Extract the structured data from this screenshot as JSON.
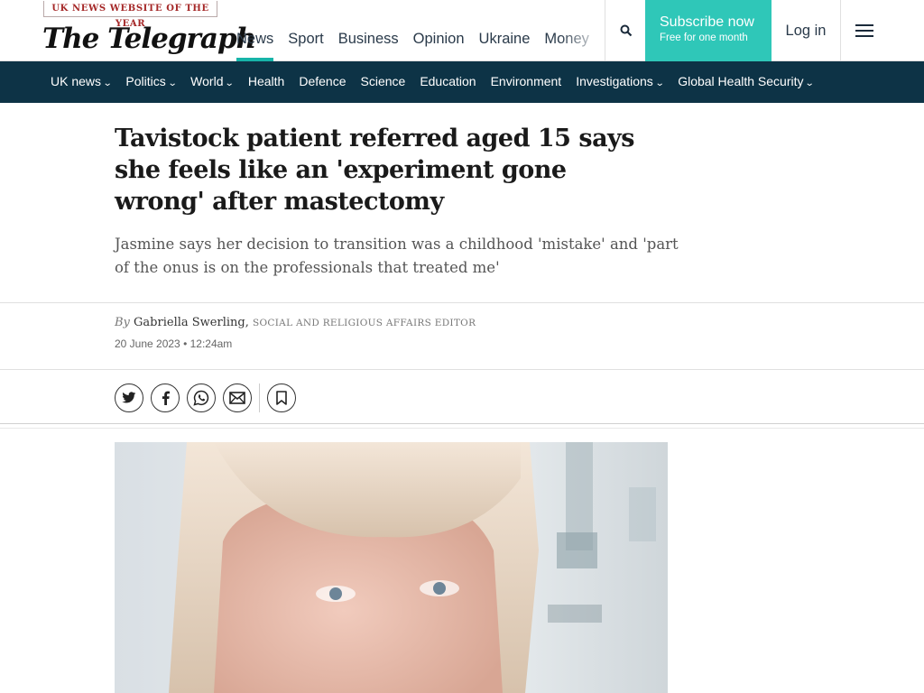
{
  "header": {
    "award_badge": "UK NEWS WEBSITE OF THE YEAR",
    "logo_text": "The Telegraph",
    "nav": [
      {
        "label": "News",
        "active": true
      },
      {
        "label": "Sport"
      },
      {
        "label": "Business"
      },
      {
        "label": "Opinion"
      },
      {
        "label": "Ukraine"
      },
      {
        "label": "Money"
      }
    ],
    "search_icon": "search-icon",
    "subscribe": {
      "title": "Subscribe now",
      "subtitle": "Free for one month"
    },
    "login_label": "Log in",
    "menu_icon": "hamburger-menu-icon",
    "accent_color": "#2fc7b8"
  },
  "section_nav": {
    "background": "#0d3346",
    "items": [
      {
        "label": "UK news",
        "dropdown": true
      },
      {
        "label": "Politics",
        "dropdown": true
      },
      {
        "label": "World",
        "dropdown": true
      },
      {
        "label": "Health"
      },
      {
        "label": "Defence"
      },
      {
        "label": "Science"
      },
      {
        "label": "Education"
      },
      {
        "label": "Environment"
      },
      {
        "label": "Investigations",
        "dropdown": true
      },
      {
        "label": "Global Health Security",
        "dropdown": true
      }
    ]
  },
  "article": {
    "headline": "Tavistock patient referred aged 15 says she feels like an 'experiment gone wrong' after mastectomy",
    "standfirst": "Jasmine says her decision to transition was a childhood 'mistake' and 'part of the onus is on the professionals that treated me'",
    "byline_prefix": "By",
    "author": "Gabriella Swerling,",
    "author_role": "Social and Religious Affairs Editor",
    "date": "20 June 2023 • 12:24am",
    "share_icons": [
      "twitter-icon",
      "facebook-icon",
      "whatsapp-icon",
      "email-icon"
    ],
    "bookmark_icon": "bookmark-icon"
  }
}
